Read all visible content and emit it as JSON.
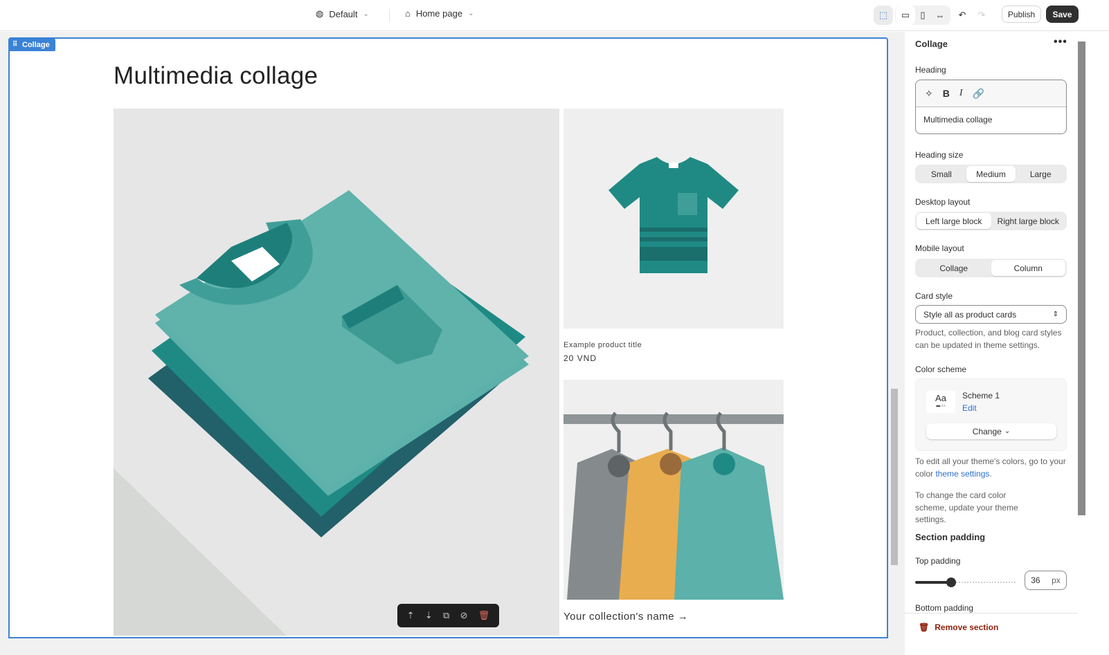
{
  "topbar": {
    "theme": "Default",
    "page": "Home page",
    "publish": "Publish",
    "save": "Save"
  },
  "preview": {
    "section_label": "Collage",
    "heading": "Multimedia collage",
    "product_title": "Example product title",
    "product_price": "20 VND",
    "collection_name": "Your collection's name",
    "collection_arrow": "→"
  },
  "panel": {
    "title": "Collage",
    "more": "•••",
    "heading_label": "Heading",
    "heading_value": "Multimedia collage",
    "heading_size_label": "Heading size",
    "heading_sizes": [
      "Small",
      "Medium",
      "Large"
    ],
    "heading_size_selected": "Medium",
    "desktop_layout_label": "Desktop layout",
    "desktop_layouts": [
      "Left large block",
      "Right large block"
    ],
    "desktop_layout_selected": "Left large block",
    "mobile_layout_label": "Mobile layout",
    "mobile_layouts": [
      "Collage",
      "Column"
    ],
    "mobile_layout_selected": "Column",
    "card_style_label": "Card style",
    "card_style_value": "Style all as product cards",
    "card_style_help": "Product, collection, and blog card styles can be updated in theme settings.",
    "color_scheme_label": "Color scheme",
    "scheme_preview": "Aa",
    "scheme_name": "Scheme 1",
    "scheme_edit": "Edit",
    "scheme_change": "Change",
    "colors_help_pre": "To edit all your theme's colors, go to your color ",
    "colors_help_link": "theme settings",
    "colors_help_post": ".",
    "card_scheme_help": "To change the card color scheme, update your theme settings.",
    "section_padding": "Section padding",
    "top_padding_label": "Top padding",
    "top_padding_value": "36",
    "top_padding_unit": "px",
    "top_padding_fraction": 0.36,
    "bottom_padding_label": "Bottom padding",
    "remove_section": "Remove section"
  },
  "colors": {
    "accent": "#3b82d6",
    "teal": "#1f8a84",
    "save": "#303030",
    "danger": "#8e1f0b"
  }
}
